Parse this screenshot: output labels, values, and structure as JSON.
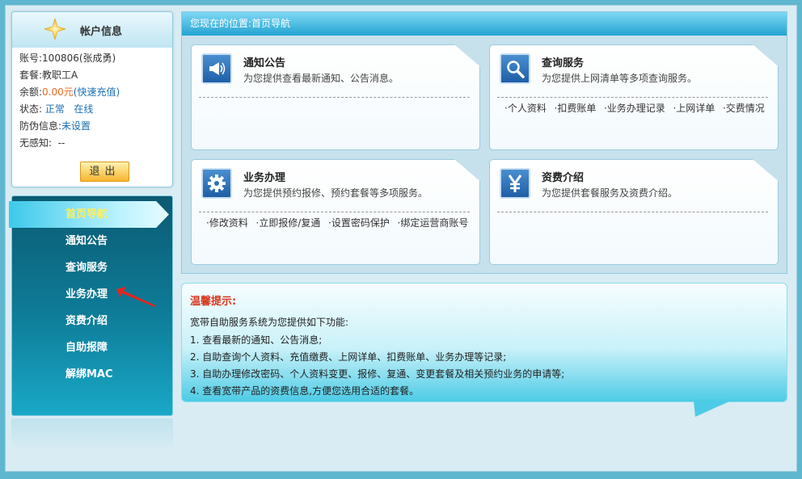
{
  "account": {
    "title": "帐户信息",
    "account_label": "账号:",
    "account_value": "100806(张成勇)",
    "plan_label": "套餐:",
    "plan_value": "教职工A",
    "balance_label": "余额:",
    "balance_value": "0.00元",
    "recharge_link": "(快速充值)",
    "status_label": "状态:",
    "status_value1": "正常",
    "status_value2": "在线",
    "antifake_label": "防伪信息:",
    "antifake_value": "未设置",
    "seamless_label": "无感知:",
    "seamless_value": "--",
    "logout": "退出"
  },
  "nav": {
    "items": [
      {
        "label": "首页导航",
        "active": true
      },
      {
        "label": "通知公告"
      },
      {
        "label": "查询服务"
      },
      {
        "label": "业务办理"
      },
      {
        "label": "资费介绍"
      },
      {
        "label": "自助报障"
      },
      {
        "label": "解绑MAC"
      }
    ]
  },
  "main": {
    "breadcrumb": "您现在的位置:首页导航",
    "cards": [
      {
        "title": "通知公告",
        "desc": "为您提供查看最新通知、公告消息。",
        "icon": "megaphone-icon",
        "links": []
      },
      {
        "title": "查询服务",
        "desc": "为您提供上网清单等多项查询服务。",
        "icon": "search-icon",
        "links": [
          "个人资料",
          "扣费账单",
          "业务办理记录",
          "上网详单",
          "交费情况"
        ]
      },
      {
        "title": "业务办理",
        "desc": "为您提供预约报修、预约套餐等多项服务。",
        "icon": "gear-icon",
        "links": [
          "修改资料",
          "立即报修/复通",
          "设置密码保护",
          "绑定运营商账号"
        ]
      },
      {
        "title": "资费介绍",
        "desc": "为您提供套餐服务及资费介绍。",
        "icon": "yen-icon",
        "links": []
      }
    ]
  },
  "tip": {
    "title": "温馨提示:",
    "intro": "宽带自助服务系统为您提供如下功能:",
    "items": [
      "1. 查看最新的通知、公告消息;",
      "2. 自助查询个人资料、充值缴费、上网详单、扣费账单、业务办理等记录;",
      "3. 自助办理修改密码、个人资料变更、报修、复通、变更套餐及相关预约业务的申请等;",
      "4. 查看宽带产品的资费信息,方便您选用合适的套餐。"
    ]
  },
  "colors": {
    "accent": "#23a3d1",
    "nav_bg": "#0b5a72",
    "active_text": "#ffef5a",
    "tip_title": "#d9361c",
    "money": "#e86a21"
  }
}
